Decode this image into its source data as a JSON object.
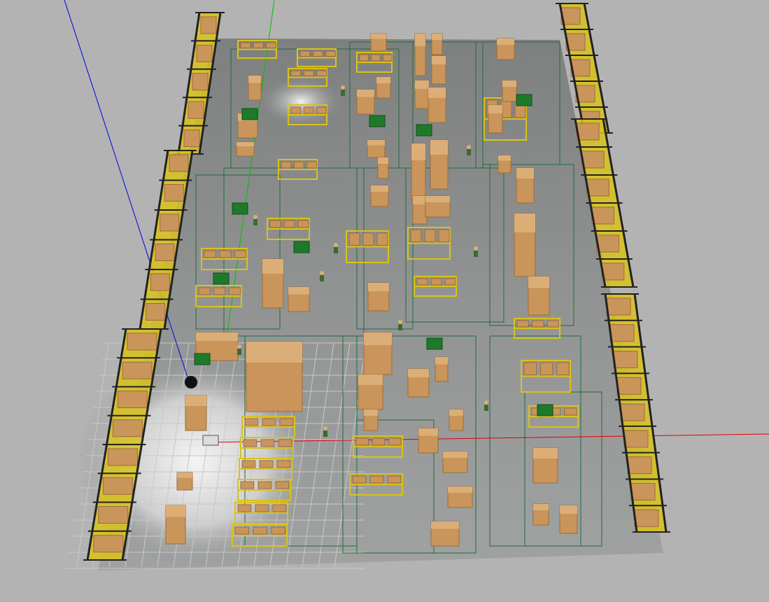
{
  "viewport": {
    "view": "3d-simulation-viewport",
    "scene": "warehouse",
    "colors": {
      "background": "#b3b3b3",
      "floor": "#8e8f8f",
      "floor_light": "#e6e6e6",
      "floor_lines": "#1f6b3c",
      "grid": "#c8c8c8",
      "shelf_yellow": "#d8c21a",
      "rack_frame": "#222222",
      "box": "#c9955a",
      "box_shade": "#9c6c3a",
      "dumpster": "#1e7a2a",
      "axis_x": "#e00000",
      "axis_y": "#00c000",
      "axis_z": "#0000e0",
      "person": "#3b6b2e"
    }
  }
}
